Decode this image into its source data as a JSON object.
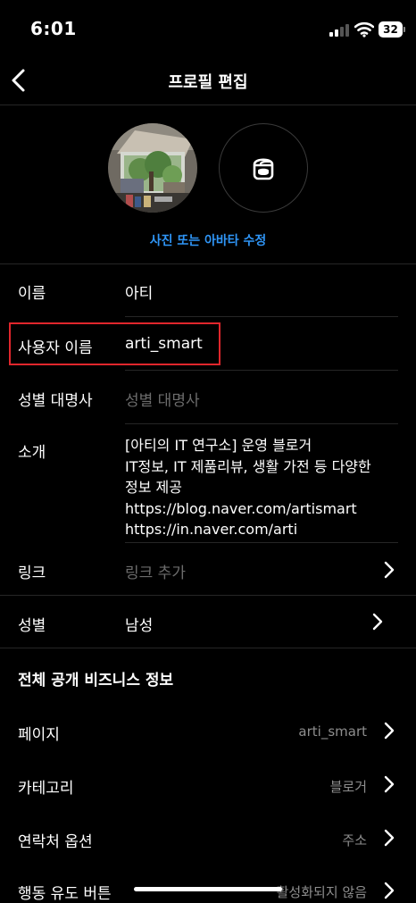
{
  "status_bar": {
    "time": "6:01",
    "battery": "32",
    "icons": [
      "signal-icon",
      "wifi-icon",
      "battery-icon"
    ]
  },
  "header": {
    "title": "프로필 편집",
    "back_icon": "chevron-left-icon"
  },
  "avatar": {
    "edit_label": "사진 또는 아바타 수정",
    "avatar_icon": "avatar-face-icon"
  },
  "fields": {
    "name": {
      "label": "이름",
      "value": "아티"
    },
    "username": {
      "label": "사용자 이름",
      "value": "arti_smart"
    },
    "pronouns": {
      "label": "성별 대명사",
      "placeholder": "성별 대명사"
    },
    "bio": {
      "label": "소개",
      "lines": [
        "[아티의 IT 연구소] 운영 블로거",
        "IT정보, IT 제품리뷰, 생활 가전 등 다양한",
        "정보 제공",
        "https://blog.naver.com/artismart",
        "https://in.naver.com/arti"
      ]
    },
    "links": {
      "label": "링크",
      "placeholder": "링크 추가"
    },
    "gender": {
      "label": "성별",
      "value": "남성"
    }
  },
  "business": {
    "section_title": "전체 공개 비즈니스 정보",
    "rows": [
      {
        "label": "페이지",
        "value": "arti_smart"
      },
      {
        "label": "카테고리",
        "value": "블로거"
      },
      {
        "label": "연락처 옵션",
        "value": "주소"
      },
      {
        "label": "행동 유도 버튼",
        "value": "활성화되지 않음"
      }
    ]
  },
  "colors": {
    "background": "#000000",
    "accent_blue": "#2f95f6",
    "highlight_red": "#e0262c",
    "divider": "#262626",
    "secondary_text": "#8e8e8e"
  }
}
